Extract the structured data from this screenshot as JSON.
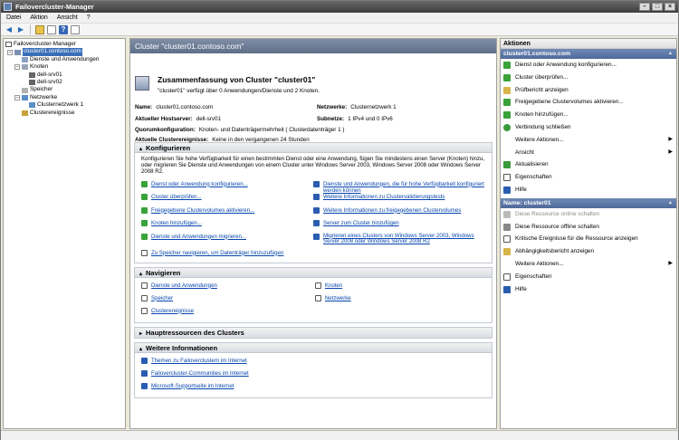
{
  "window": {
    "title": "Failovercluster-Manager"
  },
  "menu": [
    "Datei",
    "Aktion",
    "Ansicht",
    "?"
  ],
  "tree": {
    "root": "Failovercluster-Manager",
    "cluster": "cluster01.contoso.com",
    "services": "Dienste und Anwendungen",
    "nodes": "Knoten",
    "node1": "dell-srv01",
    "node2": "dell-srv02",
    "storage": "Speicher",
    "networks": "Netzwerke",
    "network1": "Clusternetzwerk 1",
    "events": "Clusterereignisse"
  },
  "center": {
    "header": "Cluster \"cluster01.contoso.com\"",
    "summary_title": "Zusammenfassung von Cluster \"cluster01\"",
    "summary_desc": "\"cluster01\" verfügt über 0 Anwendungen/Dienste und 2 Knoten.",
    "name_label": "Name:",
    "name_value": "cluster01.contoso.com",
    "host_label": "Aktueller Hostserver:",
    "host_value": "dell-srv01",
    "quorum_label": "Quorumkonfiguration:",
    "quorum_value": "Knoten- und Datenträgermehrheit ( Clusterdatenträger 1 )",
    "events_label": "Aktuelle Clusterereignisse:",
    "events_value": "Keine in den vergangenen 24 Stunden",
    "networks_label": "Netzwerke:",
    "networks_value": "Clusternetzwerk 1",
    "subnets_label": "Subnetze:",
    "subnets_value": "1 IPv4 und 0 IPv6"
  },
  "configure": {
    "title": "Konfigurieren",
    "text": "Konfigurieren Sie hohe Verfügbarkeit für einen bestimmten Dienst oder eine Anwendung, fügen Sie mindestens einen Server (Knoten) hinzu, oder migrieren Sie Dienste und Anwendungen von einem Cluster unter Windows Server 2003, Windows Server 2008 oder Windows Server 2008 R2.",
    "left": [
      "Dienst oder Anwendung konfigurieren...",
      "Cluster überprüfen...",
      "Freigegebene Clustervolumes aktivieren...",
      "Knoten hinzufügen...",
      "Dienste und Anwendungen migrieren..."
    ],
    "right": [
      "Dienste und Anwendungen, die für hohe Verfügbarkeit konfiguriert werden können",
      "Weitere Informationen zu Clustervalidierungstests",
      "Weitere Informationen zu freigegebenen Clustervolumes",
      "Server zum Cluster hinzufügen",
      "Migrieren eines Clusters von Windows Server 2003, Windows Server 2008 oder Windows Server 2008 R2"
    ],
    "bottom": "Zu Speicher navigieren, um Datenträger hinzuzufügen"
  },
  "navigate": {
    "title": "Navigieren",
    "left": [
      "Dienste und Anwendungen",
      "Speicher",
      "Clusterereignisse"
    ],
    "right": [
      "Knoten",
      "Netzwerke"
    ]
  },
  "core_resources": {
    "title": "Hauptressourcen des Clusters"
  },
  "more_info": {
    "title": "Weitere Informationen",
    "links": [
      "Themen zu Failoverclustern im Internet",
      "Failovercluster-Communities im Internet",
      "Microsoft-Supportseite im Internet"
    ]
  },
  "actions": {
    "title": "Aktionen",
    "group1": "cluster01.contoso.com",
    "items1": [
      "Dienst oder Anwendung konfigurieren...",
      "Cluster überprüfen...",
      "Prüfbericht anzeigen",
      "Freigegebene Clustervolumes aktivieren...",
      "Knoten hinzufügen...",
      "Verbindung schließen",
      "Weitere Aktionen...",
      "Ansicht",
      "Aktualisieren",
      "Eigenschaften",
      "Hilfe"
    ],
    "group2": "Name: cluster01",
    "items2": [
      "Diese Ressource online schalten",
      "Diese Ressource offline schalten",
      "Kritische Ereignisse für die Ressource anzeigen",
      "Abhängigkeitsbericht anzeigen",
      "Weitere Aktionen...",
      "Eigenschaften",
      "Hilfe"
    ]
  }
}
